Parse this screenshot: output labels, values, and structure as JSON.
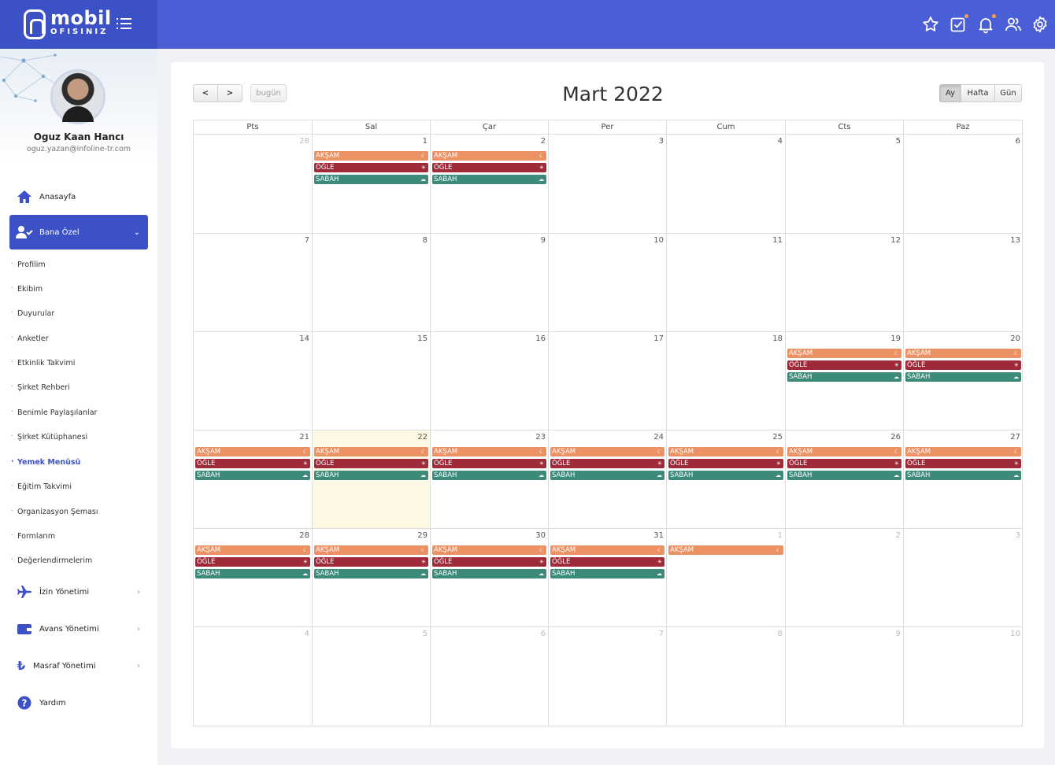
{
  "brand": {
    "line1": "mobil",
    "line2": "OFISINIZ"
  },
  "profile": {
    "name": "Oguz Kaan Hancı",
    "email": "oguz.yazan@infoline-tr.com"
  },
  "menu": {
    "home": "Anasayfa",
    "bana_ozel": "Bana Özel",
    "sub": [
      "Profilim",
      "Ekibim",
      "Duyurular",
      "Anketler",
      "Etkinlik Takvimi",
      "Şirket Rehberi",
      "Benimle Paylaşılanlar",
      "Şirket Kütüphanesi",
      "Yemek Menüsü",
      "Eğitim Takvimi",
      "Organizasyon Şeması",
      "Formlarım",
      "Değerlendirmelerim"
    ],
    "active_sub": "Yemek Menüsü",
    "izin": "İzin Yönetimi",
    "avans": "Avans Yönetimi",
    "masraf": "Masraf Yönetimi",
    "yardim": "Yardım"
  },
  "toolbar": {
    "prev": "<",
    "next": ">",
    "today": "bugün",
    "month": "Ay",
    "week": "Hafta",
    "day": "Gün"
  },
  "calendar": {
    "title": "Mart 2022",
    "weekdays": [
      "Pts",
      "Sal",
      "Çar",
      "Per",
      "Cum",
      "Cts",
      "Paz"
    ],
    "weeks": [
      [
        {
          "d": "28",
          "o": true
        },
        {
          "d": "1"
        },
        {
          "d": "2"
        },
        {
          "d": "3"
        },
        {
          "d": "4"
        },
        {
          "d": "5"
        },
        {
          "d": "6"
        }
      ],
      [
        {
          "d": "7"
        },
        {
          "d": "8"
        },
        {
          "d": "9"
        },
        {
          "d": "10"
        },
        {
          "d": "11"
        },
        {
          "d": "12"
        },
        {
          "d": "13"
        }
      ],
      [
        {
          "d": "14"
        },
        {
          "d": "15"
        },
        {
          "d": "16"
        },
        {
          "d": "17"
        },
        {
          "d": "18"
        },
        {
          "d": "19"
        },
        {
          "d": "20"
        }
      ],
      [
        {
          "d": "21"
        },
        {
          "d": "22",
          "today": true
        },
        {
          "d": "23"
        },
        {
          "d": "24"
        },
        {
          "d": "25"
        },
        {
          "d": "26"
        },
        {
          "d": "27"
        }
      ],
      [
        {
          "d": "28"
        },
        {
          "d": "29"
        },
        {
          "d": "30"
        },
        {
          "d": "31"
        },
        {
          "d": "1",
          "o": true
        },
        {
          "d": "2",
          "o": true
        },
        {
          "d": "3",
          "o": true
        }
      ],
      [
        {
          "d": "4",
          "o": true
        },
        {
          "d": "5",
          "o": true
        },
        {
          "d": "6",
          "o": true
        },
        {
          "d": "7",
          "o": true
        },
        {
          "d": "8",
          "o": true
        },
        {
          "d": "9",
          "o": true
        },
        {
          "d": "10",
          "o": true
        }
      ]
    ],
    "meal_labels": {
      "aksam": "AKŞAM",
      "ogle": "ÖĞLE",
      "sabah": "SABAH"
    },
    "meal_icons": {
      "aksam": "moon-icon",
      "ogle": "sun-icon",
      "sabah": "cloud-sun-icon"
    },
    "meal_colors": {
      "aksam": "#eb9163",
      "ogle": "#9e2a3a",
      "sabah": "#3c8a7a"
    },
    "events": [
      {
        "w": 0,
        "c": 1,
        "m": [
          "aksam",
          "ogle",
          "sabah"
        ]
      },
      {
        "w": 0,
        "c": 2,
        "m": [
          "aksam",
          "ogle",
          "sabah"
        ]
      },
      {
        "w": 2,
        "c": 5,
        "m": [
          "aksam",
          "ogle",
          "sabah"
        ]
      },
      {
        "w": 2,
        "c": 6,
        "m": [
          "aksam",
          "ogle",
          "sabah"
        ]
      },
      {
        "w": 3,
        "c": 0,
        "m": [
          "aksam",
          "ogle",
          "sabah"
        ]
      },
      {
        "w": 3,
        "c": 1,
        "m": [
          "aksam",
          "ogle",
          "sabah"
        ]
      },
      {
        "w": 3,
        "c": 2,
        "m": [
          "aksam",
          "ogle",
          "sabah"
        ]
      },
      {
        "w": 3,
        "c": 3,
        "m": [
          "aksam",
          "ogle",
          "sabah"
        ]
      },
      {
        "w": 3,
        "c": 4,
        "m": [
          "aksam",
          "ogle",
          "sabah"
        ]
      },
      {
        "w": 3,
        "c": 5,
        "m": [
          "aksam",
          "ogle",
          "sabah"
        ]
      },
      {
        "w": 3,
        "c": 6,
        "m": [
          "aksam",
          "ogle",
          "sabah"
        ]
      },
      {
        "w": 4,
        "c": 0,
        "m": [
          "aksam",
          "ogle",
          "sabah"
        ]
      },
      {
        "w": 4,
        "c": 1,
        "m": [
          "aksam",
          "ogle",
          "sabah"
        ]
      },
      {
        "w": 4,
        "c": 2,
        "m": [
          "aksam",
          "ogle",
          "sabah"
        ]
      },
      {
        "w": 4,
        "c": 3,
        "m": [
          "aksam",
          "ogle",
          "sabah"
        ]
      },
      {
        "w": 4,
        "c": 4,
        "m": [
          "aksam"
        ]
      }
    ]
  },
  "colors": {
    "header": "#4a5fd6",
    "brand": "#3d51c7",
    "today": "#fcf8e3"
  }
}
